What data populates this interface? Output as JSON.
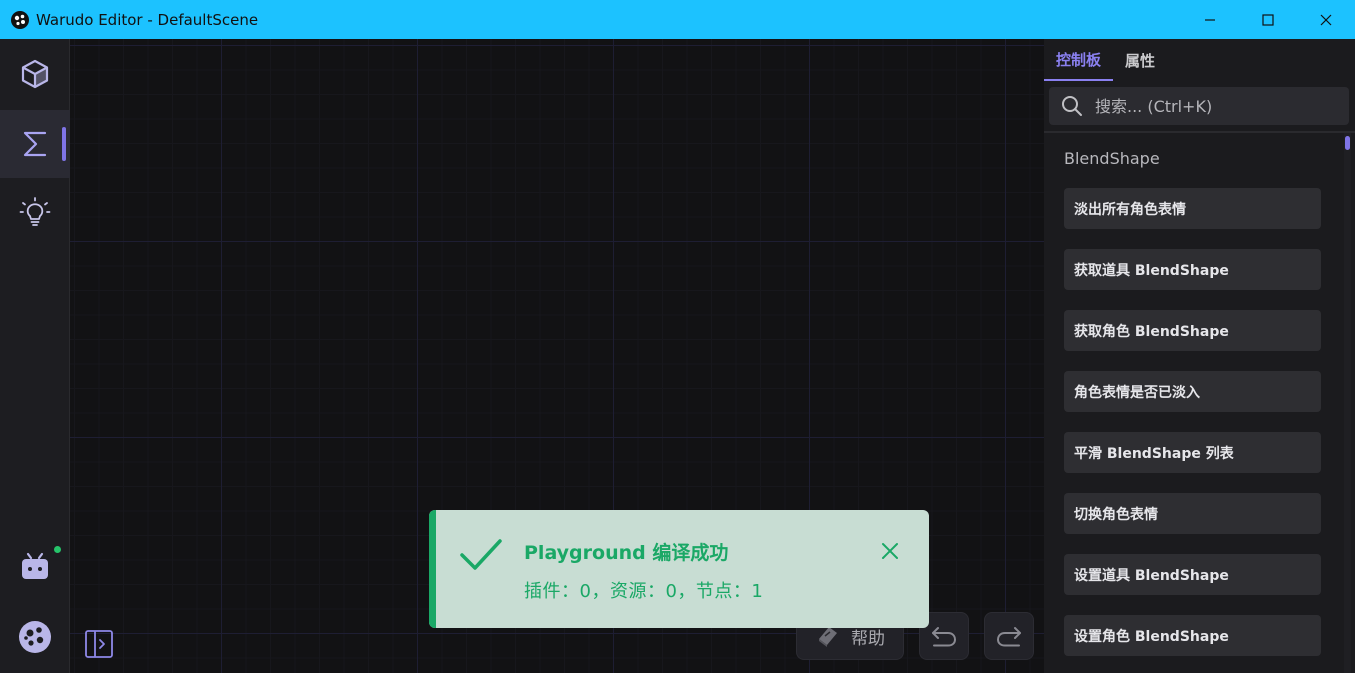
{
  "window": {
    "title": "Warudo Editor - DefaultScene"
  },
  "sidebar": {
    "items": [
      {
        "icon": "cube-icon"
      },
      {
        "icon": "sigma-icon",
        "active": true
      },
      {
        "icon": "lightbulb-icon"
      }
    ],
    "bottom": [
      {
        "icon": "bilibili-tv-icon"
      },
      {
        "icon": "warudo-logo-icon"
      }
    ]
  },
  "toast": {
    "title": "Playground 编译成功",
    "body": "插件：0，资源：0，节点：1"
  },
  "bottom_bar": {
    "help_label": "帮助"
  },
  "right_panel": {
    "tabs": [
      {
        "label": "控制板",
        "active": true
      },
      {
        "label": "属性",
        "active": false
      }
    ],
    "search_placeholder": "搜索... (Ctrl+K)",
    "section_title": "BlendShape",
    "nodes": [
      "淡出所有角色表情",
      "获取道具 BlendShape",
      "获取角色 BlendShape",
      "角色表情是否已淡入",
      "平滑 BlendShape 列表",
      "切换角色表情",
      "设置道具 BlendShape",
      "设置角色 BlendShape"
    ]
  },
  "colors": {
    "titlebar": "#1cc2ff",
    "accent": "#8a80f0",
    "success": "#1aa866"
  }
}
